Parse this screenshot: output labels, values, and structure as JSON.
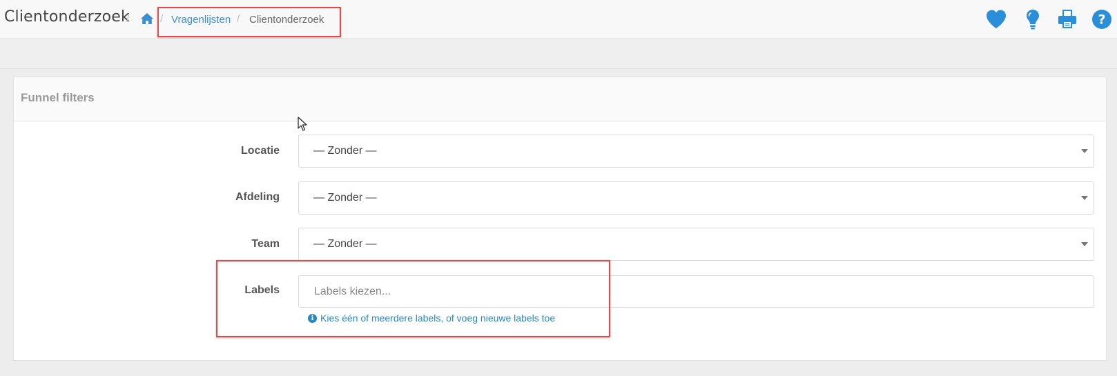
{
  "header": {
    "title": "Clientonderzoek",
    "breadcrumb": {
      "separator": "/",
      "home_icon": "home-icon",
      "items": [
        {
          "label": "Vragenlijsten"
        },
        {
          "label": "Clientonderzoek"
        }
      ]
    },
    "actions": [
      {
        "icon": "heart-icon"
      },
      {
        "icon": "lightbulb-icon"
      },
      {
        "icon": "print-icon"
      },
      {
        "icon": "help-icon"
      }
    ],
    "accent": "#2a8fd8"
  },
  "panel": {
    "title": "Funnel filters",
    "fields": {
      "locatie": {
        "label": "Locatie",
        "value": "— Zonder —"
      },
      "afdeling": {
        "label": "Afdeling",
        "value": "— Zonder —"
      },
      "team": {
        "label": "Team",
        "value": "— Zonder —"
      },
      "labels": {
        "label": "Labels",
        "placeholder": "Labels kiezen...",
        "help": "Kies één of meerdere labels, of voeg nieuwe labels toe",
        "help_icon": "info-icon"
      }
    }
  },
  "colors": {
    "link": "#3a8fd0",
    "highlight": "#e54848",
    "help_text": "#2a88c0"
  }
}
